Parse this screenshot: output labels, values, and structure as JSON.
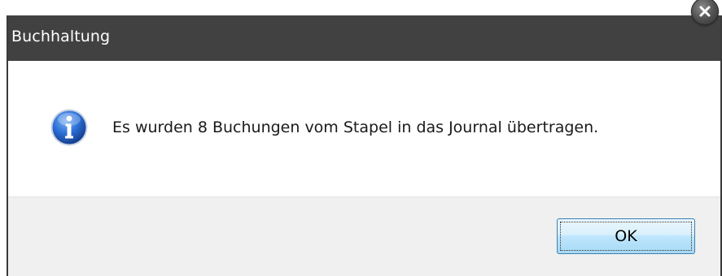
{
  "window": {
    "title": "Buchhaltung"
  },
  "dialog": {
    "icon": "info-icon",
    "message": "Es wurden 8 Buchungen vom Stapel in das Journal übertragen.",
    "ok_label": "OK"
  },
  "colors": {
    "titlebar": "#414141",
    "footer": "#f0f0f0",
    "ok_border": "#3c7fb1",
    "icon_blue": "#1f5fc2"
  }
}
